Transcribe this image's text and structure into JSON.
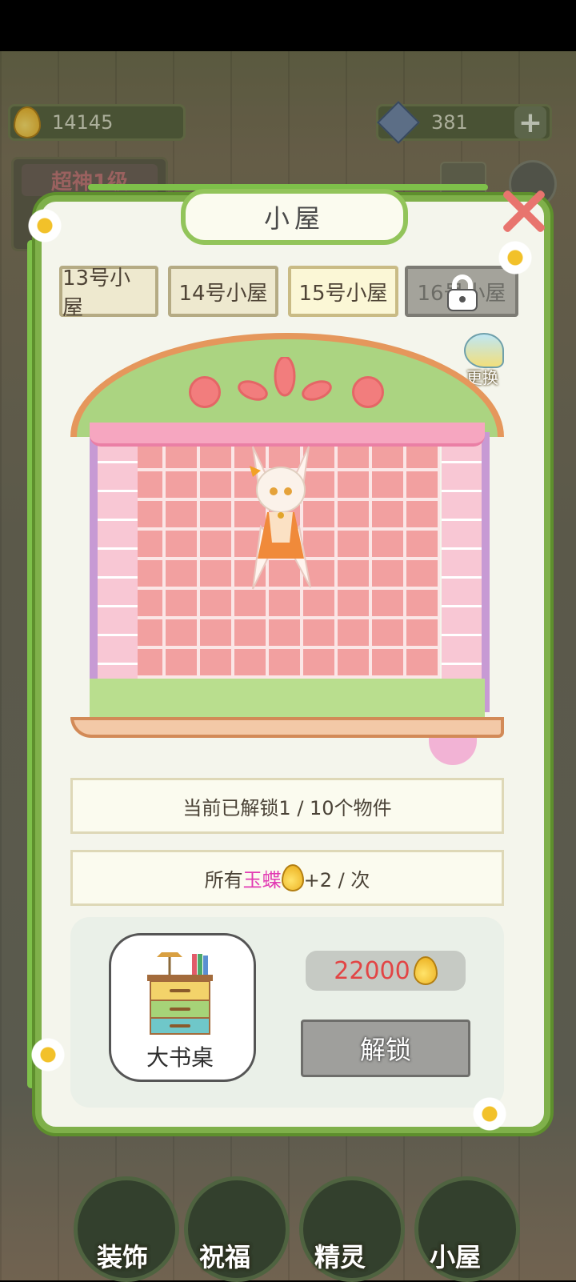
{
  "currency": {
    "drops": "14145",
    "gems": "381",
    "add_symbol": "+"
  },
  "top_left_badge": "超神1级",
  "top_right_icons": [
    "mail-icon",
    "settings-icon"
  ],
  "panel": {
    "title": "小屋",
    "tabs": [
      {
        "label": "13号小屋",
        "state": "normal"
      },
      {
        "label": "14号小屋",
        "state": "normal"
      },
      {
        "label": "15号小屋",
        "state": "selected"
      },
      {
        "label": "16号小屋",
        "state": "locked"
      }
    ],
    "change_button": "更换",
    "info_unlocked": "当前已解锁1 / 10个物件",
    "info_bonus": {
      "prefix": "所有",
      "highlight": "玉蝶",
      "suffix": "+2 / 次"
    },
    "item": {
      "name": "大书桌",
      "price": "22000",
      "unlock_button": "解锁"
    }
  },
  "bottom_nav": [
    {
      "label": "装饰"
    },
    {
      "label": "祝福"
    },
    {
      "label": "精灵"
    },
    {
      "label": "小屋"
    }
  ],
  "colors": {
    "panel_border": "#7fb04a",
    "highlight_text": "#e23bb3",
    "price_text": "#e24545"
  }
}
